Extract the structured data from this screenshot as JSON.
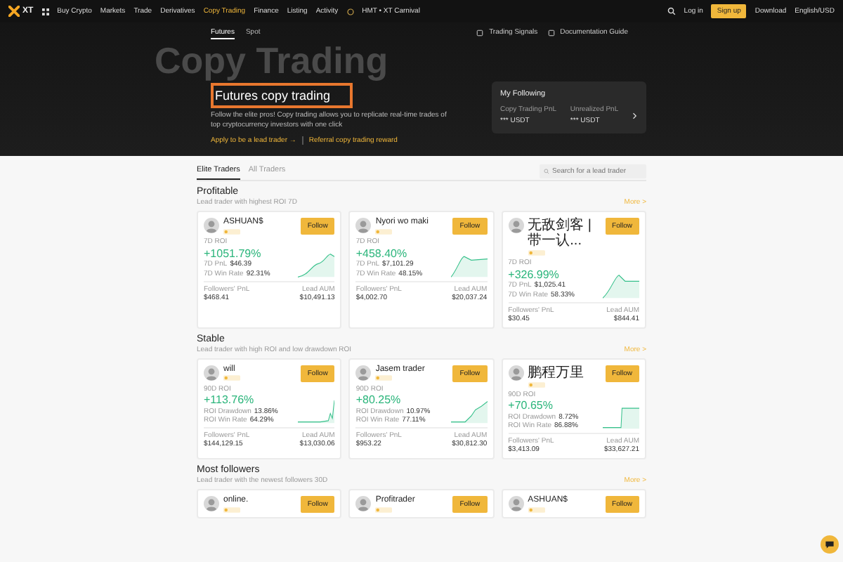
{
  "nav": {
    "logo": "XT",
    "items": [
      {
        "label": "Buy Crypto",
        "selected": false
      },
      {
        "label": "Markets",
        "selected": false
      },
      {
        "label": "Trade",
        "selected": false
      },
      {
        "label": "Derivatives",
        "selected": false
      },
      {
        "label": "Copy Trading",
        "selected": true
      },
      {
        "label": "Finance",
        "selected": false
      },
      {
        "label": "Listing",
        "selected": false
      },
      {
        "label": "Activity",
        "selected": false
      }
    ],
    "promo": "HMT • XT Carnival",
    "login": "Log in",
    "signup": "Sign up",
    "download": "Download",
    "locale": "English/USD"
  },
  "subnav": {
    "tabs": [
      {
        "label": "Futures",
        "selected": true
      },
      {
        "label": "Spot",
        "selected": false
      }
    ],
    "links": [
      "Trading Signals",
      "Documentation Guide"
    ]
  },
  "hero": {
    "watermark": "Copy Trading",
    "title": "Futures copy trading",
    "highlighted": true,
    "description": "Follow the elite pros! Copy trading allows you to replicate real-time trades of top cryptocurrency investors with one click",
    "links": [
      "Apply to be a lead trader →",
      "Referral copy trading reward"
    ],
    "following": {
      "title": "My Following",
      "stats": [
        {
          "label": "Copy Trading PnL",
          "value": "*** USDT"
        },
        {
          "label": "Unrealized PnL",
          "value": "*** USDT"
        }
      ]
    }
  },
  "traders": {
    "tabs": [
      {
        "label": "Elite Traders",
        "selected": true
      },
      {
        "label": "All Traders",
        "selected": false
      }
    ],
    "search": {
      "placeholder": "Search for a lead trader"
    }
  },
  "sections": [
    {
      "title": "Profitable",
      "subtitle": "Lead trader with highest ROI 7D",
      "more": "More >",
      "cards": [
        {
          "name": "ASHUAN$",
          "follow": "Follow",
          "roi_label": "7D ROI",
          "roi": "+1051.79%",
          "stats": [
            {
              "label": "7D PnL",
              "value": "$46.39"
            },
            {
              "label": "7D Win Rate",
              "value": "92.31%"
            }
          ],
          "footer": [
            {
              "label": "Followers' PnL",
              "value": "$468.41"
            },
            {
              "label": "Lead AUM",
              "value": "$10,491.13"
            }
          ]
        },
        {
          "name": "Nyori wo maki",
          "follow": "Follow",
          "roi_label": "7D ROI",
          "roi": "+458.40%",
          "stats": [
            {
              "label": "7D PnL",
              "value": "$7,101.29"
            },
            {
              "label": "7D Win Rate",
              "value": "48.15%"
            }
          ],
          "footer": [
            {
              "label": "Followers' PnL",
              "value": "$4,002.70"
            },
            {
              "label": "Lead AUM",
              "value": "$20,037.24"
            }
          ]
        },
        {
          "name": "无敌剑客 | 带一认...",
          "follow": "Follow",
          "roi_label": "7D ROI",
          "roi": "+326.99%",
          "stats": [
            {
              "label": "7D PnL",
              "value": "$1,025.41"
            },
            {
              "label": "7D Win Rate",
              "value": "58.33%"
            }
          ],
          "footer": [
            {
              "label": "Followers' PnL",
              "value": "$30.45"
            },
            {
              "label": "Lead AUM",
              "value": "$844.41"
            }
          ]
        }
      ]
    },
    {
      "title": "Stable",
      "subtitle": "Lead trader with high ROI and low drawdown ROI",
      "more": "More >",
      "cards": [
        {
          "name": "will",
          "follow": "Follow",
          "roi_label": "90D ROI",
          "roi": "+113.76%",
          "stats": [
            {
              "label": "ROI Drawdown",
              "value": "13.86%"
            },
            {
              "label": "ROI Win Rate",
              "value": "64.29%"
            }
          ],
          "footer": [
            {
              "label": "Followers' PnL",
              "value": "$144,129.15"
            },
            {
              "label": "Lead AUM",
              "value": "$13,030.06"
            }
          ]
        },
        {
          "name": "Jasem trader",
          "follow": "Follow",
          "roi_label": "90D ROI",
          "roi": "+80.25%",
          "stats": [
            {
              "label": "ROI Drawdown",
              "value": "10.97%"
            },
            {
              "label": "ROI Win Rate",
              "value": "77.11%"
            }
          ],
          "footer": [
            {
              "label": "Followers' PnL",
              "value": "$953.22"
            },
            {
              "label": "Lead AUM",
              "value": "$30,812.30"
            }
          ]
        },
        {
          "name": "鹏程万里",
          "follow": "Follow",
          "roi_label": "90D ROI",
          "roi": "+70.65%",
          "stats": [
            {
              "label": "ROI Drawdown",
              "value": "8.72%"
            },
            {
              "label": "ROI Win Rate",
              "value": "86.88%"
            }
          ],
          "footer": [
            {
              "label": "Followers' PnL",
              "value": "$3,413.09"
            },
            {
              "label": "Lead AUM",
              "value": "$33,627.21"
            }
          ]
        }
      ]
    },
    {
      "title": "Most followers",
      "subtitle": "Lead trader with the newest followers 30D",
      "more": "More >",
      "cards": [
        {
          "name": "online.",
          "follow": "Follow"
        },
        {
          "name": "Profitrader",
          "follow": "Follow"
        },
        {
          "name": "ASHUAN$",
          "follow": "Follow"
        }
      ]
    }
  ]
}
